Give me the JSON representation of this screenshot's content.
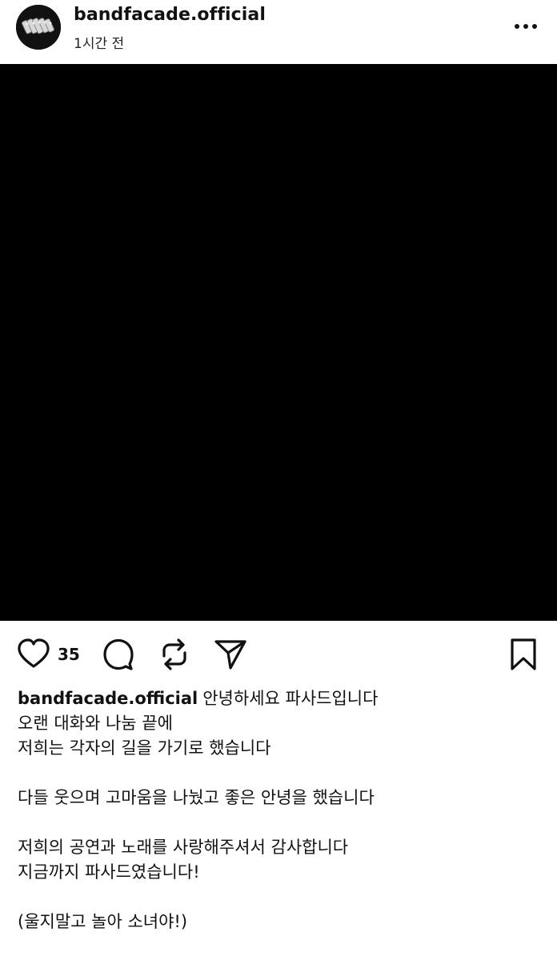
{
  "post": {
    "author": "bandfacade.official",
    "time": "1시간 전"
  },
  "actions": {
    "like_count": "35",
    "icons": {
      "like": "heart-icon",
      "comment": "comment-bubble-icon",
      "repost": "repost-icon",
      "share": "send-icon",
      "save": "bookmark-icon",
      "more": "more-dots-icon"
    }
  },
  "caption": {
    "author": "bandfacade.official",
    "lines": [
      "안녕하세요 파사드입니다",
      "오랜 대화와 나눔 끝에",
      "저희는 각자의 길을 가기로 했습니다",
      "다들 웃으며 고마움을 나눴고 좋은 안녕을 했습니다",
      "저희의 공연과 노래를 사랑해주셔서 감사합니다",
      "지금까지 파사드였습니다!",
      "(울지말고 놀아 소녀야!)"
    ]
  }
}
